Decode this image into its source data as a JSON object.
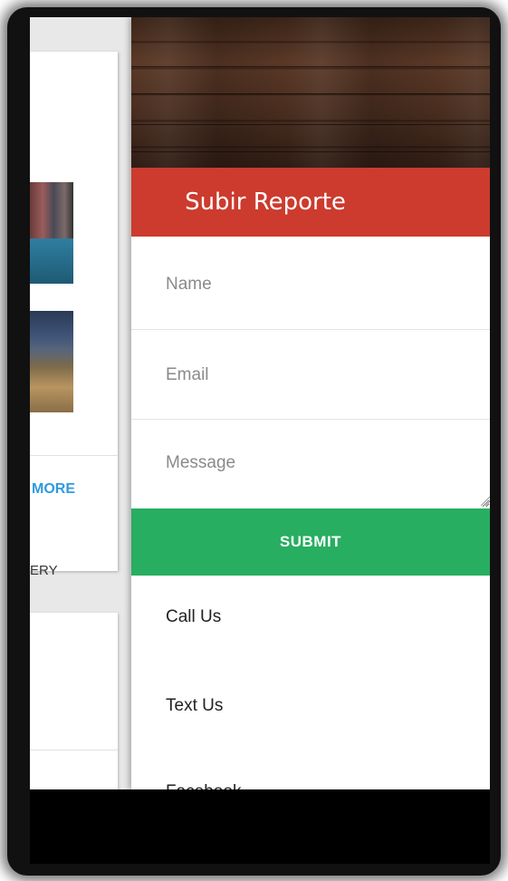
{
  "background_page": {
    "more_link": "MORE",
    "gallery_fragment": "ERY"
  },
  "drawer": {
    "title": "Subir Reporte",
    "form": {
      "name_placeholder": "Name",
      "email_placeholder": "Email",
      "message_placeholder": "Message",
      "submit_label": "SUBMIT"
    },
    "contact": {
      "call_label": "Call Us",
      "text_label": "Text Us",
      "third_label": "Facebook"
    }
  },
  "colors": {
    "header": "#cc3b2e",
    "submit": "#27ae60",
    "link": "#2e9be0"
  }
}
